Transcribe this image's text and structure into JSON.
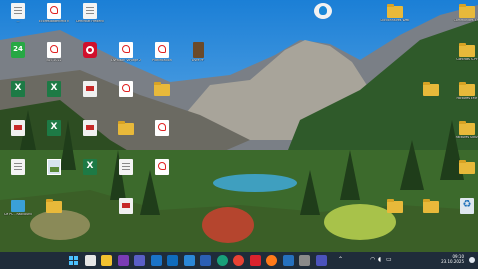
{
  "desktop": {
    "icons": [
      {
        "name": "desktop-icon-file-1",
        "type": "doc",
        "label": "...",
        "col": 0,
        "row": 0
      },
      {
        "name": "desktop-icon-pdf-1",
        "type": "pdf",
        "label": "Ecorestbatenimit non participés",
        "col": 1,
        "row": 0
      },
      {
        "name": "desktop-icon-pdf-2",
        "type": "doc",
        "label": "Certificat Frédéric",
        "col": 2,
        "row": 0
      },
      {
        "name": "desktop-icon-app-24",
        "type": "green",
        "label": "",
        "col": 0,
        "row": 1
      },
      {
        "name": "desktop-icon-pdf-3",
        "type": "pdf",
        "label": "ISIS 2022",
        "col": 1,
        "row": 1
      },
      {
        "name": "desktop-icon-red-app",
        "type": "red-circle",
        "label": "",
        "col": 2,
        "row": 1
      },
      {
        "name": "desktop-icon-pdf-4",
        "type": "pdf",
        "label": "Livraison Voyage 2024",
        "col": 3,
        "row": 1
      },
      {
        "name": "desktop-icon-pdf-5",
        "type": "pdf",
        "label": "Planification",
        "col": 4,
        "row": 1
      },
      {
        "name": "desktop-icon-book",
        "type": "book",
        "label": "Livre PF",
        "col": 5,
        "row": 1
      },
      {
        "name": "desktop-icon-xls-1",
        "type": "xls",
        "label": "",
        "col": 0,
        "row": 2
      },
      {
        "name": "desktop-icon-xls-2",
        "type": "xls",
        "label": "",
        "col": 1,
        "row": 2
      },
      {
        "name": "desktop-icon-generic-1",
        "type": "generic",
        "label": "",
        "col": 2,
        "row": 2
      },
      {
        "name": "desktop-icon-pdf-6",
        "type": "pdf",
        "label": "",
        "col": 3,
        "row": 2
      },
      {
        "name": "desktop-icon-folder-1",
        "type": "folder",
        "label": "",
        "col": 4,
        "row": 2
      },
      {
        "name": "desktop-icon-generic-2",
        "type": "generic",
        "label": "",
        "col": 0,
        "row": 3
      },
      {
        "name": "desktop-icon-xls-3",
        "type": "xls",
        "label": "",
        "col": 1,
        "row": 3
      },
      {
        "name": "desktop-icon-generic-3",
        "type": "generic",
        "label": "",
        "col": 2,
        "row": 3
      },
      {
        "name": "desktop-icon-folder-2",
        "type": "folder",
        "label": "",
        "col": 3,
        "row": 3
      },
      {
        "name": "desktop-icon-pdf-7",
        "type": "pdf",
        "label": "",
        "col": 4,
        "row": 3
      },
      {
        "name": "desktop-icon-doc-2",
        "type": "doc",
        "label": "",
        "col": 0,
        "row": 4
      },
      {
        "name": "desktop-icon-photo-1",
        "type": "photo",
        "label": "",
        "col": 1,
        "row": 4
      },
      {
        "name": "desktop-icon-xls-4",
        "type": "xls",
        "label": "",
        "col": 2,
        "row": 4
      },
      {
        "name": "desktop-icon-doc-3",
        "type": "doc",
        "label": "",
        "col": 3,
        "row": 4
      },
      {
        "name": "desktop-icon-pdf-8",
        "type": "pdf",
        "label": "",
        "col": 4,
        "row": 4
      },
      {
        "name": "desktop-icon-this-pc",
        "type": "pc",
        "label": "Ce PC - Raccourci",
        "col": 0,
        "row": 5
      },
      {
        "name": "desktop-icon-folder-3",
        "type": "folder",
        "label": "",
        "col": 1,
        "row": 5
      },
      {
        "name": "desktop-icon-generic-4",
        "type": "generic",
        "label": "",
        "col": 3,
        "row": 5
      }
    ],
    "right_icons": [
      {
        "name": "desktop-icon-gadget",
        "type": "gadget",
        "label": "",
        "col": 0,
        "row": 0
      },
      {
        "name": "desktop-icon-folder-r1",
        "type": "folder",
        "label": "Dictionnaires Web",
        "col": 2,
        "row": 0
      },
      {
        "name": "desktop-icon-folder-r2",
        "type": "folder",
        "label": "Commandes EPF",
        "col": 4,
        "row": 0
      },
      {
        "name": "desktop-icon-folder-r3",
        "type": "folder",
        "label": "Contrats S-PF",
        "col": 4,
        "row": 1
      },
      {
        "name": "desktop-icon-folder-r4",
        "type": "folder",
        "label": "",
        "col": 3,
        "row": 2
      },
      {
        "name": "desktop-icon-folder-r5",
        "type": "folder",
        "label": "Factures EMF",
        "col": 4,
        "row": 2
      },
      {
        "name": "desktop-icon-folder-r6",
        "type": "folder",
        "label": "Factures SNSF",
        "col": 4,
        "row": 3
      },
      {
        "name": "desktop-icon-folder-r7",
        "type": "folder",
        "label": "",
        "col": 4,
        "row": 4
      },
      {
        "name": "desktop-icon-folder-r8",
        "type": "folder",
        "label": "",
        "col": 2,
        "row": 5
      },
      {
        "name": "desktop-icon-folder-r9",
        "type": "folder",
        "label": "",
        "col": 3,
        "row": 5
      },
      {
        "name": "desktop-icon-recycle-bin",
        "type": "recycle",
        "label": "",
        "col": 4,
        "row": 5
      }
    ]
  },
  "taskbar": {
    "apps": [
      "start",
      "search",
      "file-explorer",
      "onenote",
      "teams",
      "outlook",
      "mail",
      "calendar",
      "word",
      "edge",
      "chrome",
      "acrobat",
      "firefox",
      "powershell",
      "settings",
      "teams-2"
    ],
    "clock_time": "09:10",
    "clock_date": "23.10.2025"
  }
}
